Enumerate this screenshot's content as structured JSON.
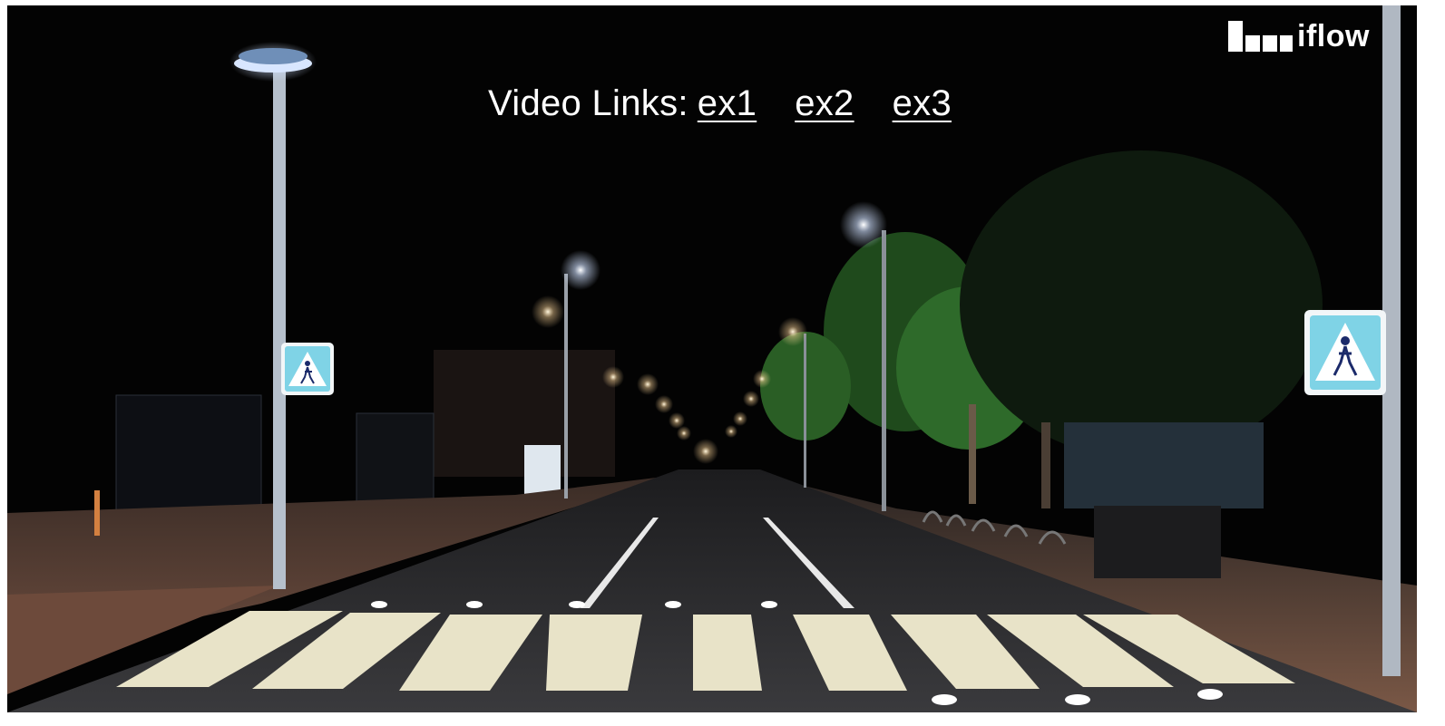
{
  "video_links": {
    "prefix": "Video Links:",
    "items": [
      "ex1",
      "ex2",
      "ex3"
    ]
  },
  "logo": {
    "text": "iflow"
  },
  "scene": {
    "description_icon": "pedestrian-crossing-sign-icon",
    "colors": {
      "sky": "#030303",
      "road": "#2a2a2c",
      "sidewalk": "#5a4438",
      "crosswalk": "#e8e3c8",
      "lamp_glow": "#dfe8ff",
      "sign_bg": "#7fd3e6",
      "tree": "#2e6a2a"
    }
  }
}
